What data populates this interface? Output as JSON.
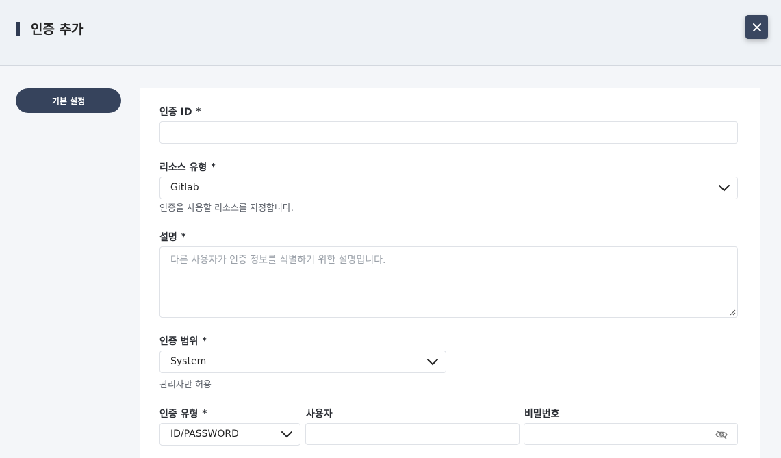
{
  "header": {
    "title": "인증 추가",
    "close_icon": "close-icon"
  },
  "sidebar": {
    "items": [
      {
        "label": "기본 설정"
      }
    ]
  },
  "form": {
    "required_mark": "*",
    "auth_id": {
      "label": "인증 ID",
      "value": ""
    },
    "resource_type": {
      "label": "리소스 유형",
      "value": "Gitlab",
      "help": "인증을 사용할 리소스를 지정합니다."
    },
    "description": {
      "label": "설명",
      "value": "",
      "placeholder": "다른 사용자가 인증 정보를 식별하기 위한 설명입니다."
    },
    "auth_scope": {
      "label": "인증 범위",
      "value": "System",
      "help": "관리자만 허용"
    },
    "auth_type": {
      "label": "인증 유형",
      "value": "ID/PASSWORD"
    },
    "user": {
      "label": "사용자",
      "value": ""
    },
    "password": {
      "label": "비밀번호",
      "value": "",
      "icon": "eye-slash-icon"
    }
  },
  "colors": {
    "header_bg": "#eef2f6",
    "accent": "#36435c",
    "close_bg": "#3a4760"
  }
}
